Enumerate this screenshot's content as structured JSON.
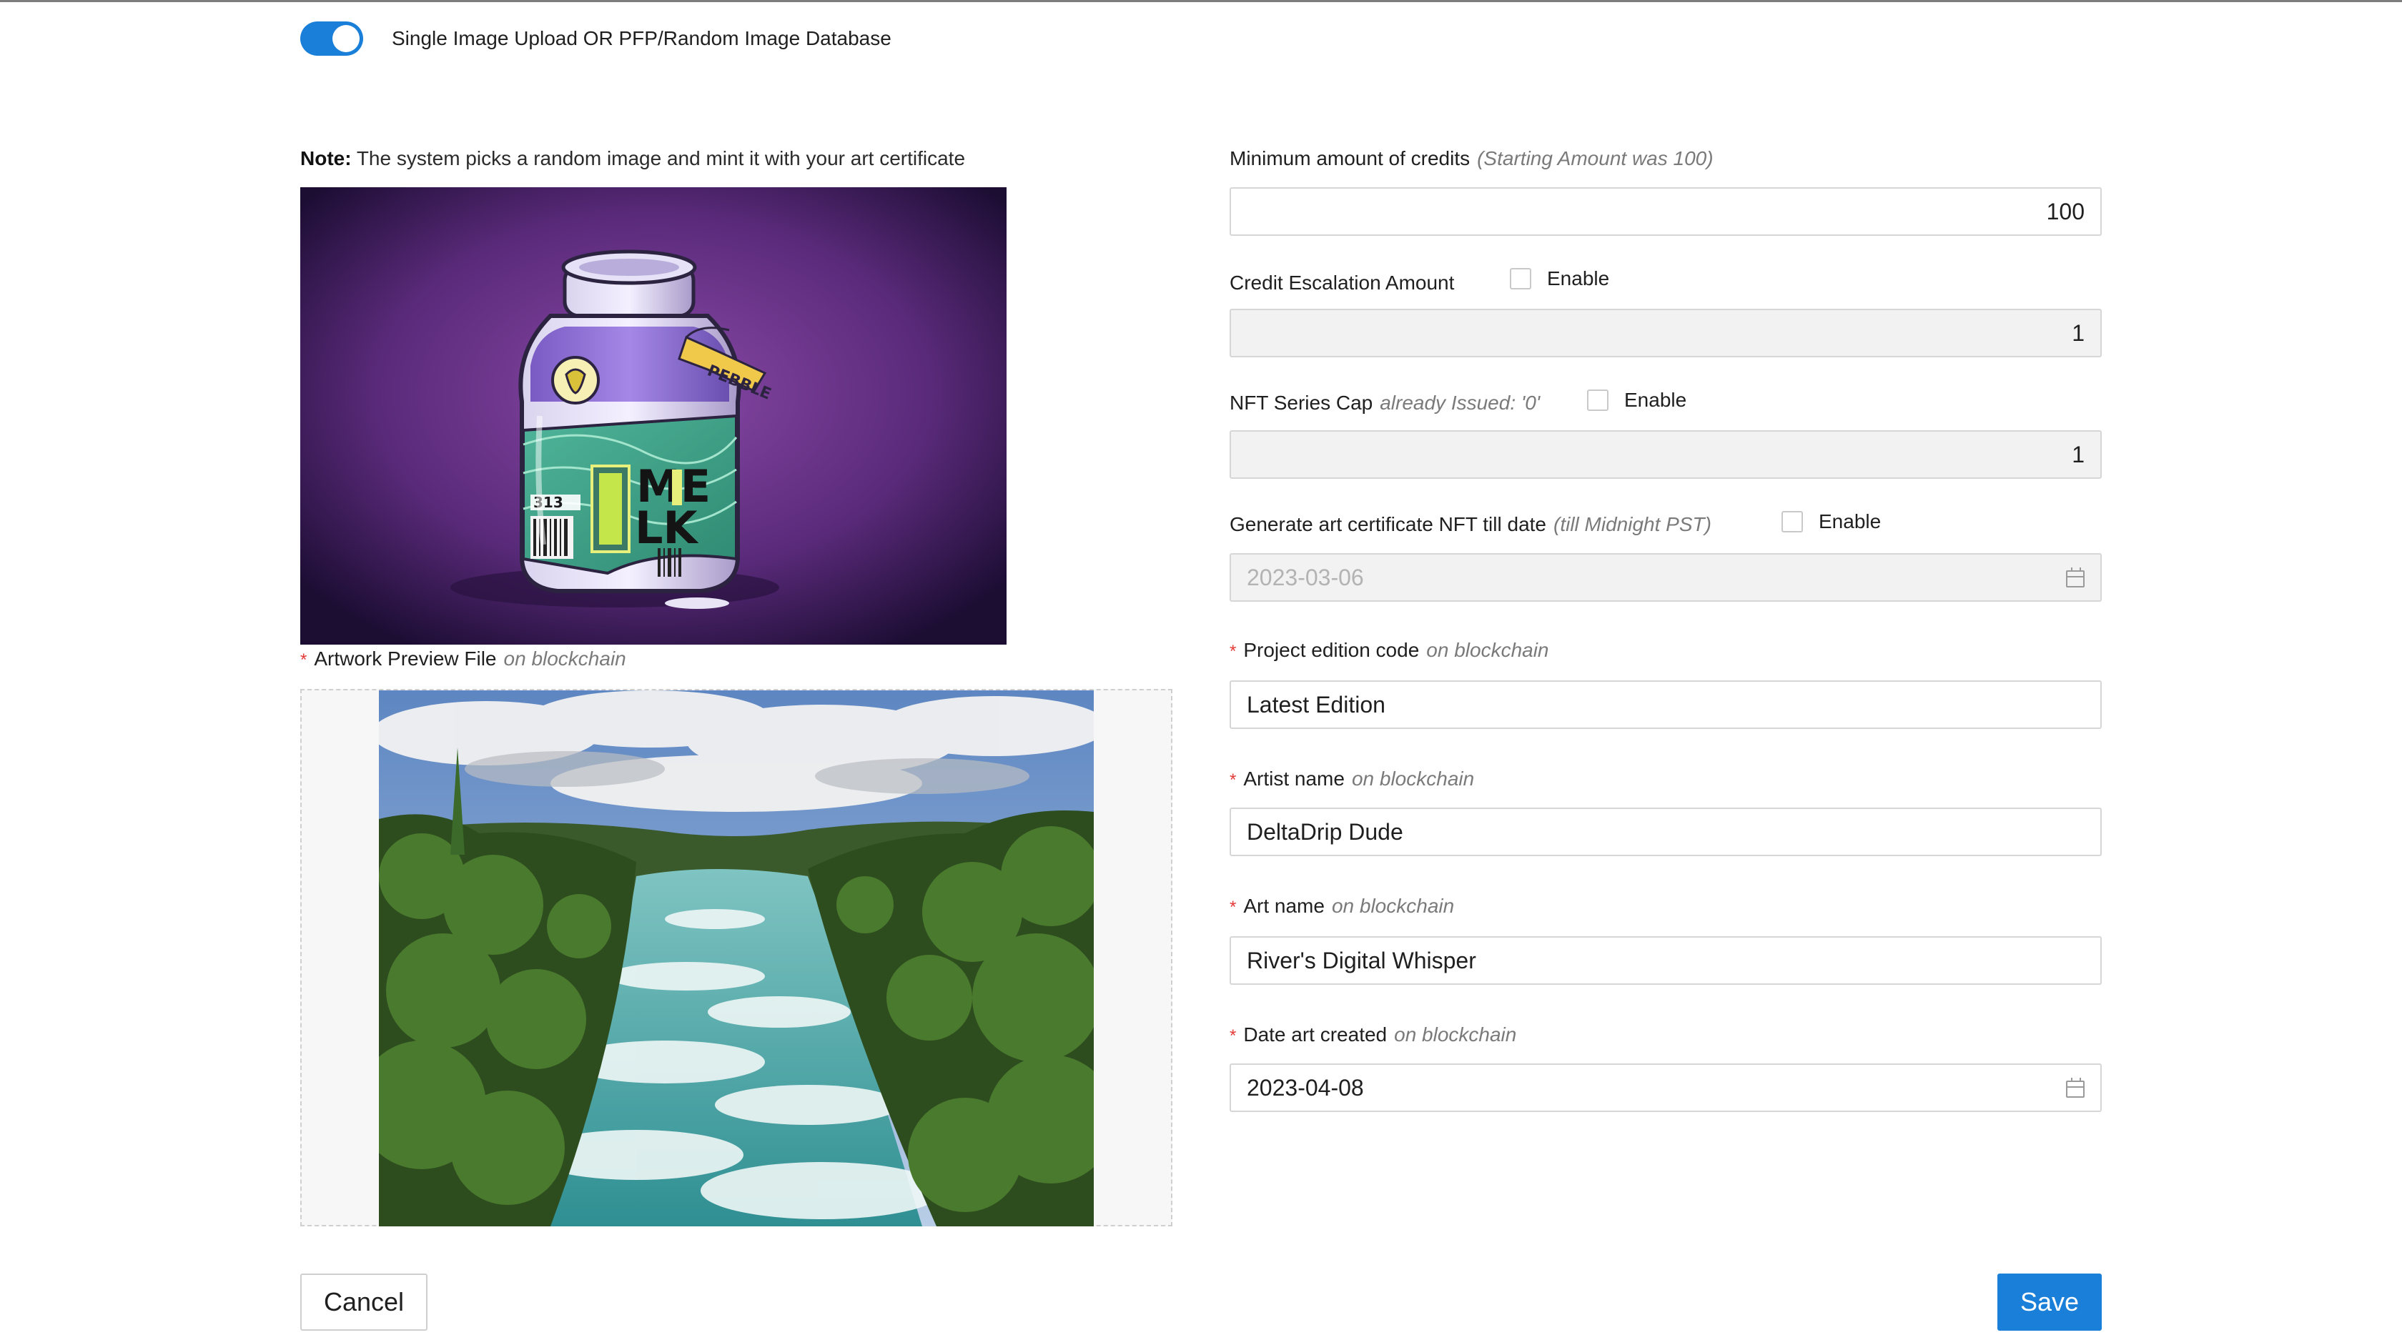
{
  "toggle": {
    "label": "Single Image Upload OR PFP/Random Image Database",
    "on": true
  },
  "note": {
    "prefix": "Note:",
    "text": " The system picks a random image and mint it with your art certificate"
  },
  "artwork_preview": {
    "label": "Artwork Preview File",
    "hint": "on blockchain"
  },
  "min_credits": {
    "label": "Minimum amount of credits",
    "hint": "(Starting Amount was 100)",
    "value": "100"
  },
  "credit_escalation": {
    "label": "Credit Escalation Amount",
    "checkbox_label": "Enable",
    "value": "1"
  },
  "series_cap": {
    "label": "NFT Series Cap",
    "hint": "already Issued: '0'",
    "checkbox_label": "Enable",
    "value": "1"
  },
  "till_date": {
    "label": "Generate art certificate NFT till date",
    "hint": "(till Midnight PST)",
    "checkbox_label": "Enable",
    "value": "2023-03-06"
  },
  "edition_code": {
    "label": "Project edition code",
    "hint": "on blockchain",
    "value": "Latest Edition"
  },
  "artist_name": {
    "label": "Artist name",
    "hint": "on blockchain",
    "value": "DeltaDrip Dude"
  },
  "art_name": {
    "label": "Art name",
    "hint": "on blockchain",
    "value": "River's Digital Whisper"
  },
  "date_created": {
    "label": "Date art created",
    "hint": "on blockchain",
    "value": "2023-04-08"
  },
  "milk_bottle": {
    "label_lines": [
      "ME",
      "LK"
    ],
    "tag": "PEBBLE",
    "code": "313"
  },
  "buttons": {
    "cancel": "Cancel",
    "save": "Save"
  },
  "required_mark": "*",
  "colors": {
    "accent": "#1a7fd8",
    "required": "#e53935"
  },
  "icons": {
    "calendar": "calendar-icon"
  }
}
